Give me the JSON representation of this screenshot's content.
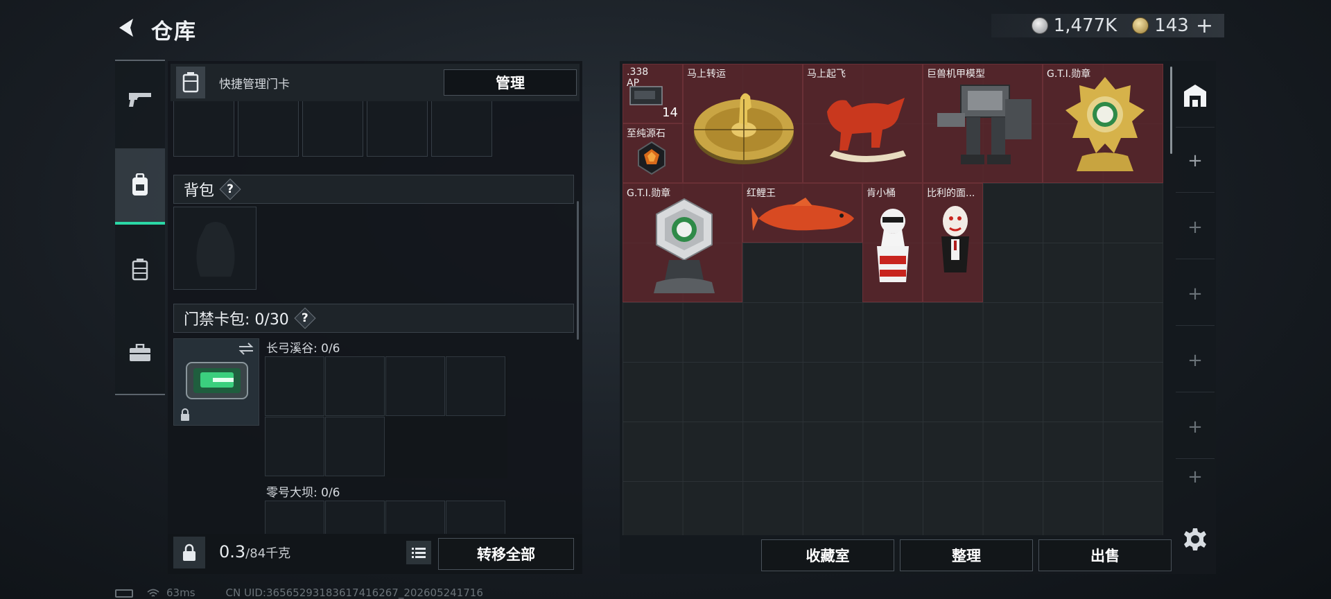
{
  "header": {
    "title": "仓库"
  },
  "currency": {
    "silver": "1,477K",
    "gold": "143",
    "add_label": "+"
  },
  "quick_card": {
    "label": "快捷管理门卡",
    "manage_button": "管理"
  },
  "backpack": {
    "label": "背包",
    "help": "?"
  },
  "keycard_pack": {
    "label": "门禁卡包: 0/30",
    "help": "?"
  },
  "maps": [
    {
      "name": "长弓溪谷: 0/6"
    },
    {
      "name": "零号大坝: 0/6"
    }
  ],
  "weight": {
    "current": "0.3",
    "max": "/84千克"
  },
  "transfer_button": "转移全部",
  "stash_items": [
    {
      "name": ".338 AP",
      "count": "14"
    },
    {
      "name": "至纯源石",
      "count": ""
    },
    {
      "name": "马上转运",
      "count": ""
    },
    {
      "name": "马上起飞",
      "count": ""
    },
    {
      "name": "巨兽机甲模型",
      "count": ""
    },
    {
      "name": "G.T.I.勋章",
      "count": ""
    },
    {
      "name": "G.T.I.勋章",
      "count": ""
    },
    {
      "name": "红鲤王",
      "count": ""
    },
    {
      "name": "肯小桶",
      "count": ""
    },
    {
      "name": "比利的面...",
      "count": ""
    }
  ],
  "right_tabs": [
    "+",
    "+",
    "+",
    "+",
    "+",
    "+"
  ],
  "bottom_buttons": {
    "collection": "收藏室",
    "sort": "整理",
    "sell": "出售"
  },
  "status_bar": {
    "ping": "63ms",
    "uid": "CN UID:3656529318361741626​7_202605241716"
  },
  "colors": {
    "accent": "#2bd8a6",
    "item_bg": "#62262c"
  }
}
